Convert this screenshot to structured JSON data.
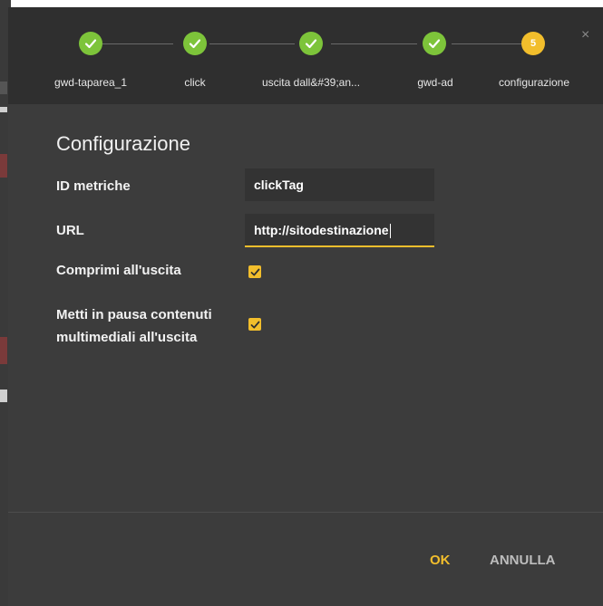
{
  "stepper": {
    "steps": [
      {
        "label": "gwd-taparea_1",
        "state": "done"
      },
      {
        "label": "click",
        "state": "done"
      },
      {
        "label": "uscita dall&#39;an...",
        "state": "done"
      },
      {
        "label": "gwd-ad",
        "state": "done"
      },
      {
        "label": "configurazione",
        "state": "current",
        "number": "5"
      }
    ],
    "close_glyph": "×"
  },
  "form": {
    "title": "Configurazione",
    "metric_id_label": "ID metriche",
    "metric_id_value": "clickTag",
    "url_label": "URL",
    "url_value": "http://sitodestinazione",
    "collapse_label": "Comprimi all'uscita",
    "collapse_checked": true,
    "pause_label_line1": "Metti in pausa contenuti",
    "pause_label_line2": "multimediali all'uscita",
    "pause_checked": true
  },
  "footer": {
    "ok_label": "OK",
    "cancel_label": "ANNULLA"
  },
  "colors": {
    "accent": "#f2be2c",
    "done": "#7dc43a",
    "dialog_bg": "#3c3c3c",
    "header_bg": "#2f2f2f"
  }
}
